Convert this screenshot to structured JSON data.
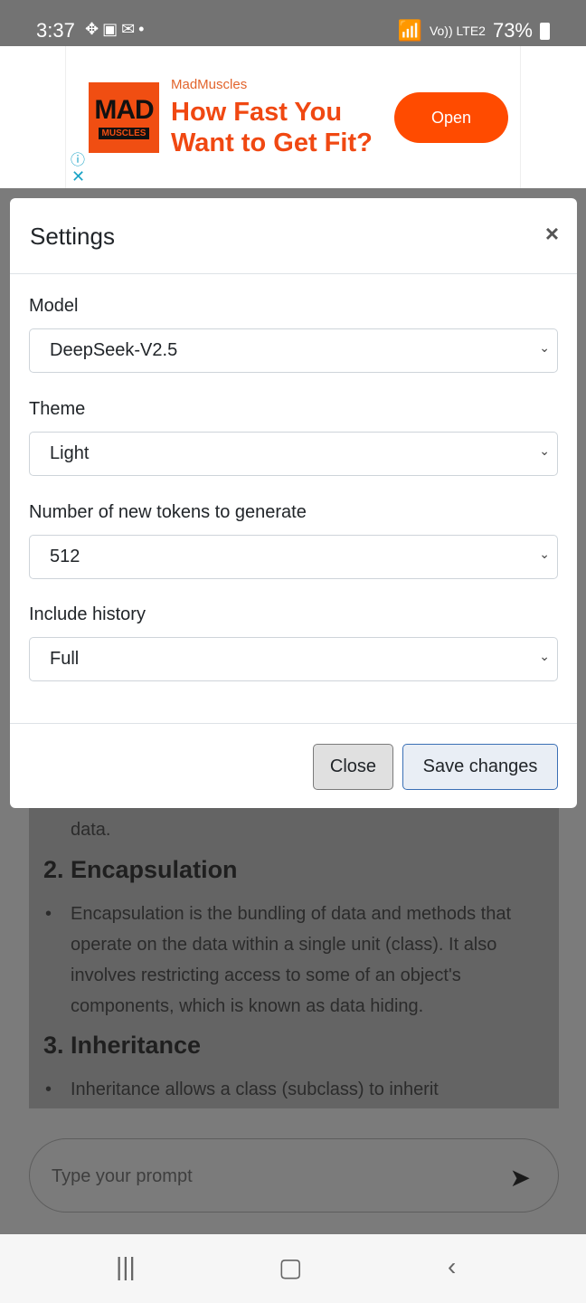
{
  "status_bar": {
    "time": "3:37",
    "notification_icons": [
      "dropbox-icon",
      "gallery-icon",
      "outlook-icon",
      "dot-icon"
    ],
    "network": "Vo)) LTE2",
    "battery": "73%"
  },
  "ad": {
    "brand": "MadMuscles",
    "logo_top": "MAD",
    "logo_bottom": "MUSCLES",
    "headline_1": "How Fast You",
    "headline_2": "Want to Get Fit?",
    "cta": "Open",
    "accent": "#ff4b00"
  },
  "modal": {
    "title": "Settings",
    "close_symbol": "×",
    "fields": [
      {
        "label": "Model",
        "value": "DeepSeek-V2.5"
      },
      {
        "label": "Theme",
        "value": "Light"
      },
      {
        "label": "Number of new tokens to generate",
        "value": "512"
      },
      {
        "label": "Include history",
        "value": "Full"
      }
    ],
    "close_label": "Close",
    "save_label": "Save changes"
  },
  "background": {
    "p0": "data.",
    "h2": "2. Encapsulation",
    "p1": "Encapsulation is the bundling of data and methods that operate on the data within a single unit (class). It also involves restricting access to some of an object's components, which is known as data hiding.",
    "h3": "3. Inheritance",
    "p2": "Inheritance allows a class (subclass) to inherit"
  },
  "prompt": {
    "placeholder": "Type your prompt"
  }
}
